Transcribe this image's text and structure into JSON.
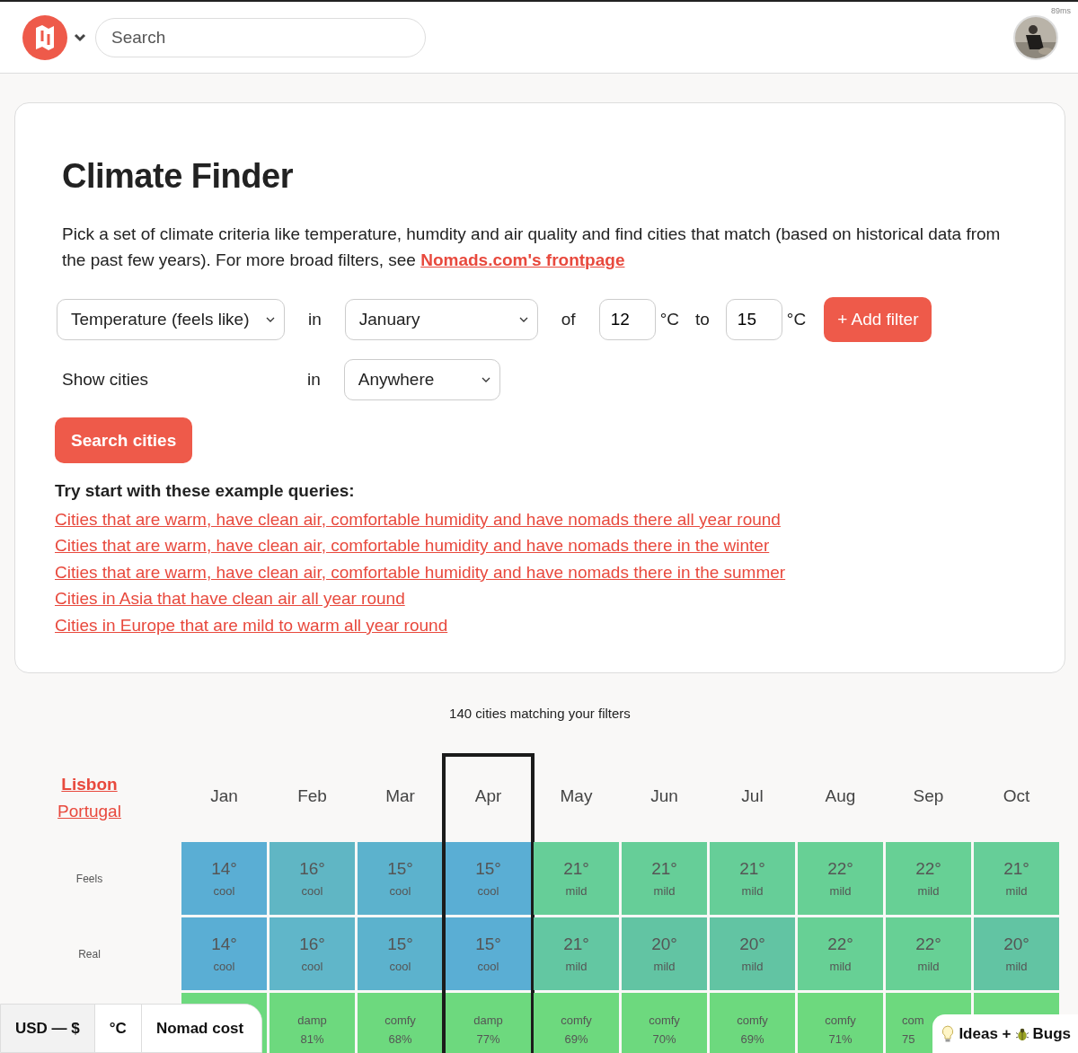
{
  "header": {
    "search": {
      "placeholder": "Search"
    },
    "timing": "89ms"
  },
  "finder": {
    "title": "Climate Finder",
    "intro": "Pick a set of climate criteria like temperature, humdity and air quality and find cities that match (based on historical data from the past few years). For more broad filters, see ",
    "intro_link": "Nomads.com's frontpage",
    "filter": {
      "metric": "Temperature (feels like)",
      "in": "in",
      "month": "January",
      "of": "of",
      "from": "12",
      "unit_from": "°C",
      "to": "to",
      "upto": "15",
      "unit_to": "°C",
      "add_button": "+ Add filter"
    },
    "location": {
      "label": "Show cities",
      "in": "in",
      "region": "Anywhere"
    },
    "search_button": "Search cities",
    "examples_title": "Try start with these example queries:",
    "examples": [
      "Cities that are warm, have clean air, comfortable humidity and have nomads there all year round",
      "Cities that are warm, have clean air, comfortable humidity and have nomads there in the winter",
      "Cities that are warm, have clean air, comfortable humidity and have nomads there in the summer",
      "Cities in Asia that have clean air all year round",
      "Cities in Europe that are mild to warm all year round"
    ]
  },
  "results": {
    "count": "140 cities matching your filters",
    "city": {
      "name": "Lisbon",
      "country": "Portugal"
    },
    "row_labels": [
      "Feels",
      "Real"
    ],
    "months": [
      {
        "label": "Jan",
        "selected": false,
        "cells": [
          {
            "value": "14°",
            "note": "cool",
            "color": "#5aaed4"
          },
          {
            "value": "14°",
            "note": "cool",
            "color": "#5aaed4"
          },
          {
            "color": "#6dd97e"
          }
        ]
      },
      {
        "label": "Feb",
        "selected": false,
        "cells": [
          {
            "value": "16°",
            "note": "cool",
            "color": "#60b6c4"
          },
          {
            "value": "16°",
            "note": "cool",
            "color": "#60b6c9"
          },
          {
            "value": "damp",
            "note": "81%",
            "color": "#6dd97e"
          }
        ]
      },
      {
        "label": "Mar",
        "selected": false,
        "cells": [
          {
            "value": "15°",
            "note": "cool",
            "color": "#5cb2cd"
          },
          {
            "value": "15°",
            "note": "cool",
            "color": "#5cb2cd"
          },
          {
            "value": "comfy",
            "note": "68%",
            "color": "#6dd97e"
          }
        ]
      },
      {
        "label": "Apr",
        "selected": true,
        "cells": [
          {
            "value": "15°",
            "note": "cool",
            "color": "#5aaed4"
          },
          {
            "value": "15°",
            "note": "cool",
            "color": "#5aaed4"
          },
          {
            "value": "damp",
            "note": "77%",
            "color": "#6dd97e"
          }
        ]
      },
      {
        "label": "May",
        "selected": false,
        "cells": [
          {
            "value": "21°",
            "note": "mild",
            "color": "#66ce98"
          },
          {
            "value": "21°",
            "note": "mild",
            "color": "#63c7a2"
          },
          {
            "value": "comfy",
            "note": "69%",
            "color": "#6dd97e"
          }
        ]
      },
      {
        "label": "Jun",
        "selected": false,
        "cells": [
          {
            "value": "21°",
            "note": "mild",
            "color": "#66ce98"
          },
          {
            "value": "20°",
            "note": "mild",
            "color": "#62c4a3"
          },
          {
            "value": "comfy",
            "note": "70%",
            "color": "#6dd97e"
          }
        ]
      },
      {
        "label": "Jul",
        "selected": false,
        "cells": [
          {
            "value": "21°",
            "note": "mild",
            "color": "#66ce98"
          },
          {
            "value": "20°",
            "note": "mild",
            "color": "#62c4a3"
          },
          {
            "value": "comfy",
            "note": "69%",
            "color": "#6dd97e"
          }
        ]
      },
      {
        "label": "Aug",
        "selected": false,
        "cells": [
          {
            "value": "22°",
            "note": "mild",
            "color": "#67d095"
          },
          {
            "value": "22°",
            "note": "mild",
            "color": "#67d095"
          },
          {
            "value": "comfy",
            "note": "71%",
            "color": "#6dd97e"
          }
        ]
      },
      {
        "label": "Sep",
        "selected": false,
        "cells": [
          {
            "value": "22°",
            "note": "mild",
            "color": "#67d095"
          },
          {
            "value": "22°",
            "note": "mild",
            "color": "#67d095"
          },
          {
            "value": "com",
            "note": "75",
            "color": "#6dd97e",
            "partial": true
          }
        ]
      },
      {
        "label": "Oct",
        "selected": false,
        "cells": [
          {
            "value": "21°",
            "note": "mild",
            "color": "#66ce98"
          },
          {
            "value": "20°",
            "note": "mild",
            "color": "#62c4a3"
          },
          {
            "color": "#6dd97e"
          }
        ]
      }
    ]
  },
  "settings_bar": [
    {
      "label": "USD — $",
      "selected": true
    },
    {
      "label": "°C",
      "selected": false
    },
    {
      "label": "Nomad cost",
      "selected": false
    }
  ],
  "feedback_button": {
    "ideas": "Ideas +",
    "bugs": "Bugs"
  }
}
